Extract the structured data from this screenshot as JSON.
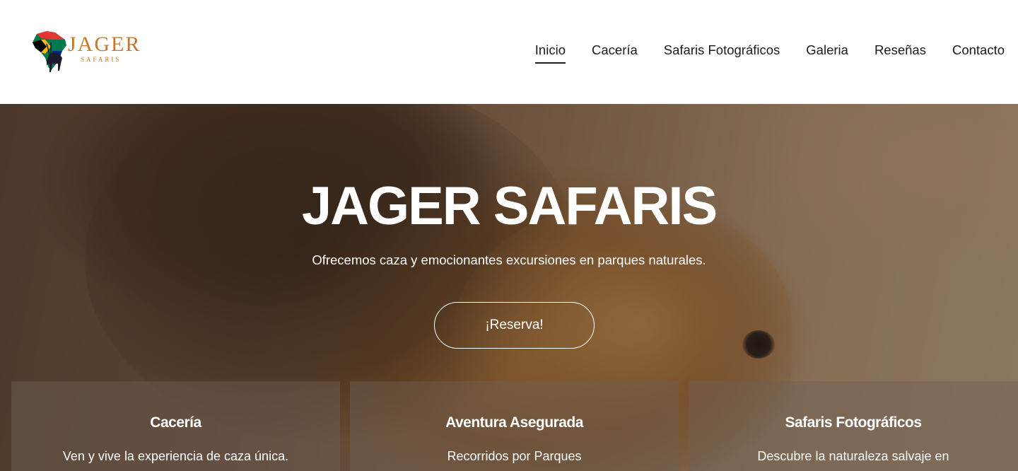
{
  "brand": {
    "name": "JAGER",
    "tagline": "SAFARIS",
    "logo_icon": "africa-map-antelope-logo",
    "accent_color": "#c8772a"
  },
  "nav": {
    "items": [
      {
        "label": "Inicio",
        "active": true
      },
      {
        "label": "Cacería",
        "active": false
      },
      {
        "label": "Safaris Fotográficos",
        "active": false
      },
      {
        "label": "Galeria",
        "active": false
      },
      {
        "label": "Reseñas",
        "active": false
      },
      {
        "label": "Contacto",
        "active": false
      }
    ]
  },
  "hero": {
    "title": "JAGER SAFARIS",
    "subtitle": "Ofrecemos caza y emocionantes excursiones en parques naturales.",
    "cta_label": "¡Reserva!",
    "background": "lion"
  },
  "cards": [
    {
      "title": "Cacería",
      "text": "Ven y vive la experiencia de caza única."
    },
    {
      "title": "Aventura Asegurada",
      "text": "Recorridos por Parques"
    },
    {
      "title": "Safaris Fotográficos",
      "text": "Descubre la naturaleza salvaje en"
    }
  ]
}
